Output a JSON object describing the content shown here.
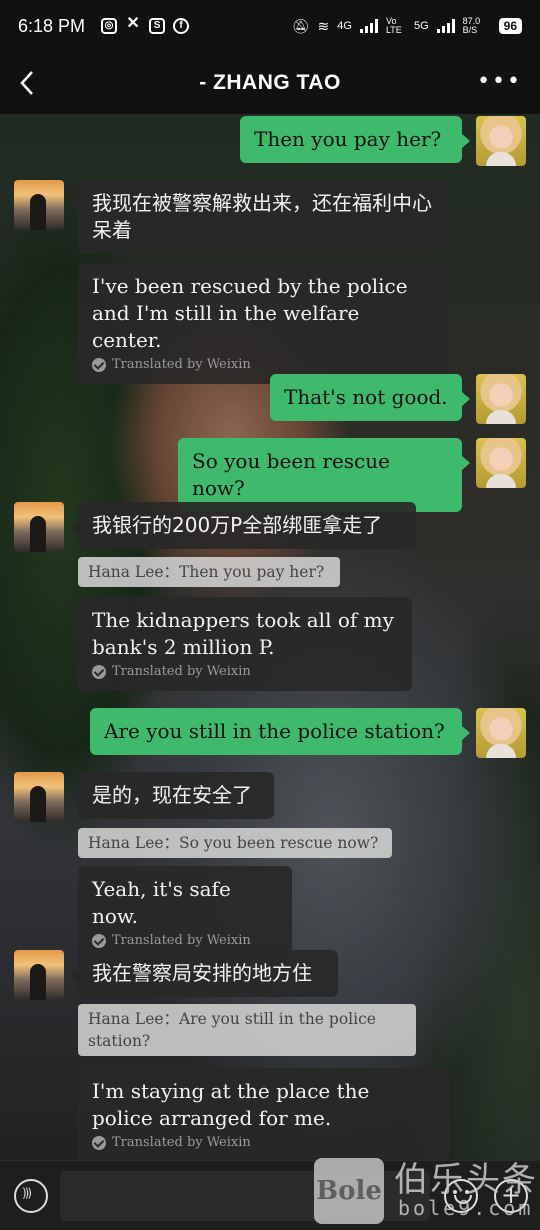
{
  "status_bar": {
    "time": "6:18 PM",
    "net_4g": "4G",
    "volte": "Vo LTE",
    "net_5g": "5G",
    "speed": "87.0 B/S",
    "battery": "96"
  },
  "header": {
    "title": "- ZHANG TAO",
    "more": "•••"
  },
  "messages": [
    {
      "side": "self",
      "text": "Then you pay her?"
    },
    {
      "side": "other",
      "text": "我现在被警察解救出来，还在福利中心呆着"
    },
    {
      "side": "other",
      "translation": "I've been rescued by the police and I'm still in the welfare center.",
      "translated_by": "Translated by Weixin"
    },
    {
      "side": "self",
      "text": "That's not good."
    },
    {
      "side": "self",
      "text": "So you been rescue now?"
    },
    {
      "side": "other",
      "text": "我银行的200万P全部绑匪拿走了",
      "quote": "Hana Lee：Then you pay her?"
    },
    {
      "side": "other",
      "translation": "The kidnappers took all of my bank's 2 million P.",
      "translated_by": "Translated by Weixin"
    },
    {
      "side": "self",
      "text": "Are you still in the police station?"
    },
    {
      "side": "other",
      "text": "是的，现在安全了",
      "quote": "Hana Lee：So you been rescue now?"
    },
    {
      "side": "other",
      "translation": "Yeah, it's safe now.",
      "translated_by": "Translated by Weixin"
    },
    {
      "side": "other",
      "text": "我在警察局安排的地方住",
      "quote": "Hana Lee：Are you still in the police station?"
    },
    {
      "side": "other",
      "translation": "I'm staying at the place the police arranged for me.",
      "translated_by": "Translated by Weixin"
    }
  ],
  "input_bar": {
    "placeholder": "",
    "plus": "+"
  },
  "watermark": {
    "logo": "Bole",
    "cn": "伯乐头条",
    "url": "bole9.com"
  }
}
